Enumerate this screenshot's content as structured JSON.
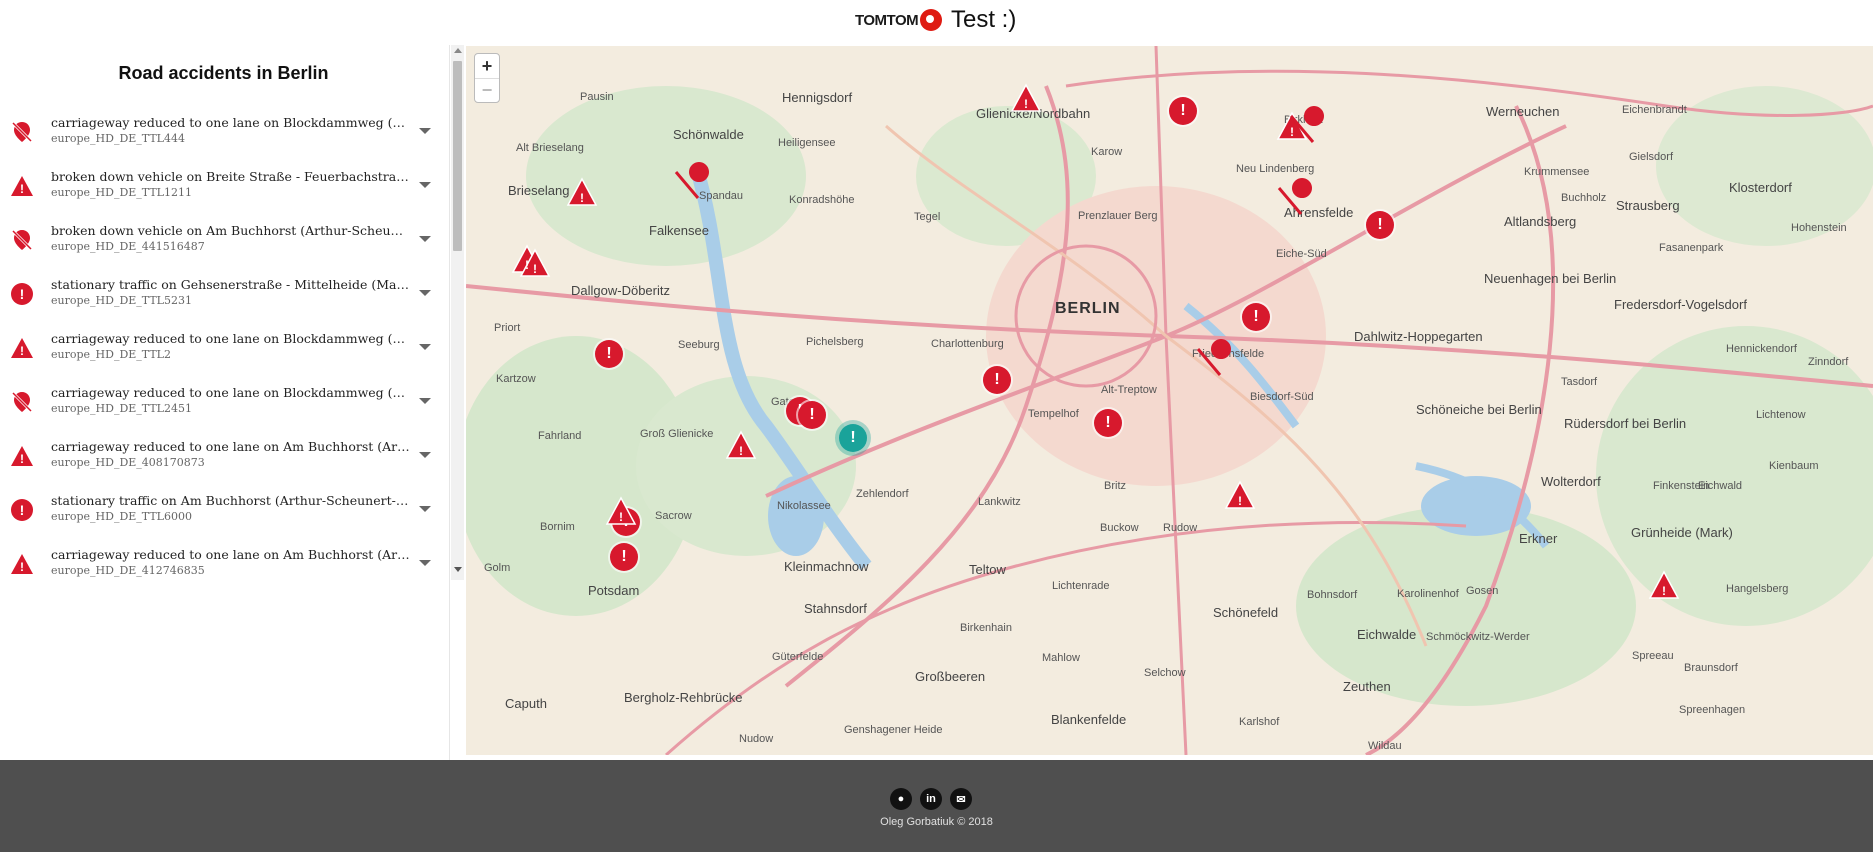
{
  "header": {
    "logo_text": "TOMTOM",
    "title": "Test :)"
  },
  "sidebar": {
    "title": "Road accidents in Berlin",
    "incidents": [
      {
        "icon": "lane-closed-icon",
        "title": "carriageway reduced to one lane on Blockdammweg (Rum...",
        "id": "europe_HD_DE_TTL444"
      },
      {
        "icon": "warning-triangle-icon",
        "title": "broken down vehicle on Breite Straße - Feuerbachstraße (Ze...",
        "id": "europe_HD_DE_TTL1211"
      },
      {
        "icon": "lane-closed-icon",
        "title": "broken down vehicle on Am Buchhorst (Arthur-Scheunert-A...",
        "id": "europe_HD_DE_441516487"
      },
      {
        "icon": "alert-circle-icon",
        "title": "stationary traffic on Gehsenerstraße - Mittelheide (Mahlsdo...",
        "id": "europe_HD_DE_TTL5231"
      },
      {
        "icon": "warning-triangle-icon",
        "title": "carriageway reduced to one lane on Blockdammweg (Rum...",
        "id": "europe_HD_DE_TTL2"
      },
      {
        "icon": "lane-closed-icon",
        "title": "carriageway reduced to one lane on Blockdammweg (Rum...",
        "id": "europe_HD_DE_TTL2451"
      },
      {
        "icon": "warning-triangle-icon",
        "title": "carriageway reduced to one lane on Am Buchhorst (Arthur-...",
        "id": "europe_HD_DE_408170873"
      },
      {
        "icon": "alert-circle-icon",
        "title": "stationary traffic on Am Buchhorst (Arthur-Scheunert-Allee/...",
        "id": "europe_HD_DE_TTL6000"
      },
      {
        "icon": "warning-triangle-icon",
        "title": "carriageway reduced to one lane on Am Buchhorst (Arthur-...",
        "id": "europe_HD_DE_412746835"
      }
    ]
  },
  "map": {
    "zoom_in": "+",
    "zoom_out": "−",
    "labels": [
      "BERLIN",
      "Pausin",
      "Hennigsdorf",
      "Glienicke/Nordbahn",
      "Birkholz",
      "Werneuchen",
      "Eichenbrandt",
      "Schönwalde",
      "Heiligensee",
      "Karow",
      "Neu Lindenberg",
      "Krummensee",
      "Gielsdorf",
      "Alt Brieselang",
      "Brieselang",
      "Spandau",
      "Konradshöhe",
      "Tegel",
      "Ahrensfelde",
      "Altlandsberg",
      "Strausberg",
      "Klosterdorf",
      "Falkensee",
      "Prenzlauer Berg",
      "Eiche-Süd",
      "Buchholz",
      "Hohenstein",
      "Fasanenpark",
      "Dallgow-Döberitz",
      "Neuenhagen bei Berlin",
      "Fredersdorf-Vogelsdorf",
      "Seeburg",
      "Pichelsberg",
      "Charlottenburg",
      "Dahlwitz-Hoppegarten",
      "Kartzow",
      "Friedrichsfelde",
      "Hennickendorf",
      "Zinndorf",
      "Priort",
      "Biesdorf-Süd",
      "Tasdorf",
      "Alt-Treptow",
      "Schöneiche bei Berlin",
      "Rüdersdorf bei Berlin",
      "Fahrland",
      "Groß Glienicke",
      "Gatow",
      "Tempelhof",
      "Lichtenow",
      "Wolterdorf",
      "Kienbaum",
      "Eichwald",
      "Britz",
      "Finkenstein",
      "Zehlendorf",
      "Lankwitz",
      "Nikolassee",
      "Sacrow",
      "Bornim",
      "Buckow",
      "Rudow",
      "Erkner",
      "Grünheide (Mark)",
      "Kleinmachnow",
      "Golm",
      "Potsdam",
      "Stahnsdorf",
      "Teltow",
      "Lichtenrade",
      "Bohnsdorf",
      "Karolinenhof",
      "Gosen",
      "Hangelsberg",
      "Schönefeld",
      "Eichwalde",
      "Schmöckwitz-Werder",
      "Spreeau",
      "Birkenhain",
      "Mahlow",
      "Zeuthen",
      "Bergholz-Rehbrücke",
      "Güterfelde",
      "Großbeeren",
      "Selchow",
      "Braunsdorf",
      "Caputh",
      "Blankenfelde",
      "Spreenhagen",
      "Genshagener Heide",
      "Nudow",
      "Wildau",
      "Karlshof"
    ]
  },
  "footer": {
    "icons": [
      "github-icon",
      "linkedin-icon",
      "mail-icon"
    ],
    "copyright": "Oleg Gorbatiuk © 2018"
  },
  "colors": {
    "incident_red": "#d7192d",
    "selected_teal": "#1aa39a",
    "footer_bg": "#4f4f4f"
  }
}
